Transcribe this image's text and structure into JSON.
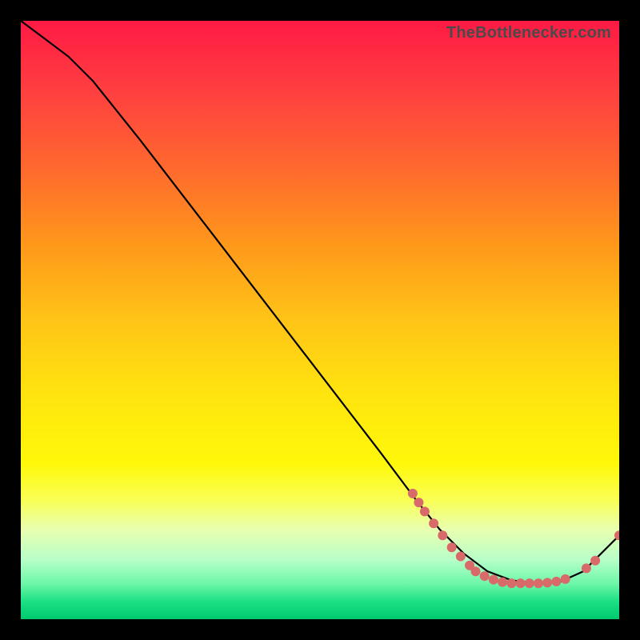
{
  "watermark": "TheBottlenecker.com",
  "chart_data": {
    "type": "line",
    "title": "",
    "xlabel": "",
    "ylabel": "",
    "xlim": [
      0,
      100
    ],
    "ylim": [
      0,
      100
    ],
    "grid": false,
    "series": [
      {
        "name": "curve",
        "color": "#000000",
        "x": [
          0,
          4,
          8,
          12,
          20,
          30,
          40,
          50,
          60,
          66,
          70,
          74,
          78,
          82,
          86,
          90,
          94,
          100
        ],
        "y": [
          100,
          97,
          94,
          90,
          80,
          67,
          54,
          41,
          28,
          20,
          15,
          11,
          8,
          6.5,
          6,
          6.2,
          8,
          14
        ]
      }
    ],
    "markers": [
      {
        "x": 65.5,
        "y": 21.0
      },
      {
        "x": 66.5,
        "y": 19.5
      },
      {
        "x": 67.5,
        "y": 18.0
      },
      {
        "x": 69.0,
        "y": 16.0
      },
      {
        "x": 70.5,
        "y": 14.0
      },
      {
        "x": 72.0,
        "y": 12.0
      },
      {
        "x": 73.5,
        "y": 10.5
      },
      {
        "x": 75.0,
        "y": 9.0
      },
      {
        "x": 76.0,
        "y": 8.0
      },
      {
        "x": 77.5,
        "y": 7.2
      },
      {
        "x": 79.0,
        "y": 6.6
      },
      {
        "x": 80.5,
        "y": 6.2
      },
      {
        "x": 82.0,
        "y": 6.0
      },
      {
        "x": 83.5,
        "y": 6.0
      },
      {
        "x": 85.0,
        "y": 6.0
      },
      {
        "x": 86.5,
        "y": 6.0
      },
      {
        "x": 88.0,
        "y": 6.1
      },
      {
        "x": 89.5,
        "y": 6.3
      },
      {
        "x": 91.0,
        "y": 6.7
      },
      {
        "x": 94.5,
        "y": 8.5
      },
      {
        "x": 96.0,
        "y": 9.8
      },
      {
        "x": 100.0,
        "y": 14.0
      }
    ],
    "marker_style": {
      "color": "#d86a6a",
      "radius_px": 6
    }
  }
}
